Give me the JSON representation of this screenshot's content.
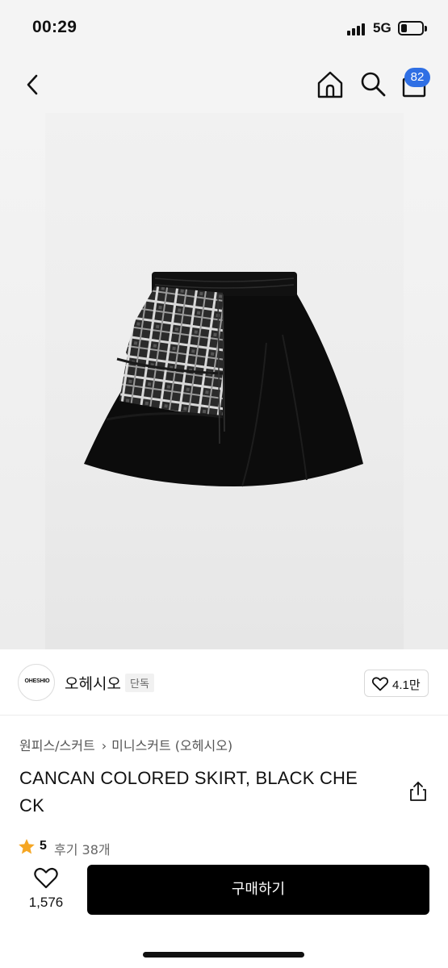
{
  "status_bar": {
    "time": "00:29",
    "network": "5G",
    "battery_level": 0.3
  },
  "nav": {
    "back_icon": "chevron-left-icon",
    "home_icon": "home-icon",
    "search_icon": "search-icon",
    "cart_icon": "shopping-bag-icon",
    "cart_count": "82",
    "badge_color": "#2f6fe4"
  },
  "product_image": {
    "subject": "skirt-image"
  },
  "brand": {
    "logo_text": "OHESHIO",
    "name": "오헤시오",
    "badge": "단독",
    "likes": "4.1만"
  },
  "breadcrumb": {
    "category": "원피스/스커트",
    "subcategory": "미니스커트 (오헤시오)"
  },
  "product": {
    "title": "CANCAN COLORED SKIRT, BLACK CHECK",
    "title_line1": "CANCAN COLORED SKIRT, BLACK CHE",
    "title_line2": "CK"
  },
  "rating": {
    "score": "5",
    "reviews": "후기 38개",
    "star_color": "#f5a623"
  },
  "bottom_bar": {
    "wish_count": "1,576",
    "buy_label": "구매하기"
  }
}
